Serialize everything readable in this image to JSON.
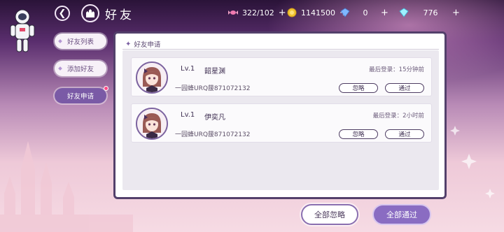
{
  "header": {
    "title": "好友",
    "resources": [
      {
        "icon": "candy-icon",
        "value": "322/102"
      },
      {
        "icon": "gold-coin-icon",
        "value": "1141500"
      },
      {
        "icon": "blue-diamond-icon",
        "value": "0"
      },
      {
        "icon": "cyan-diamond-icon",
        "value": "776"
      }
    ]
  },
  "sidebar": {
    "tabs": [
      {
        "label": "好友列表",
        "active": false
      },
      {
        "label": "添加好友",
        "active": false
      },
      {
        "label": "好友申请",
        "active": true
      }
    ]
  },
  "panel": {
    "title": "好友申请",
    "requests": [
      {
        "level": "Lv.1",
        "name": "韶星渊",
        "last_login": "最后登录：15分钟前",
        "signature": "一园蜂URQ菝871072132",
        "ignore_label": "忽略",
        "accept_label": "通过"
      },
      {
        "level": "Lv.1",
        "name": "伊奕凡",
        "last_login": "最后登录：2小时前",
        "signature": "一园蜂URQ菝871072132",
        "ignore_label": "忽略",
        "accept_label": "通过"
      }
    ]
  },
  "footer": {
    "ignore_all": "全部忽略",
    "accept_all": "全部通过"
  },
  "colors": {
    "accent": "#8a6cc2",
    "panel_border": "#53406b",
    "badge": "#ff4a86"
  }
}
